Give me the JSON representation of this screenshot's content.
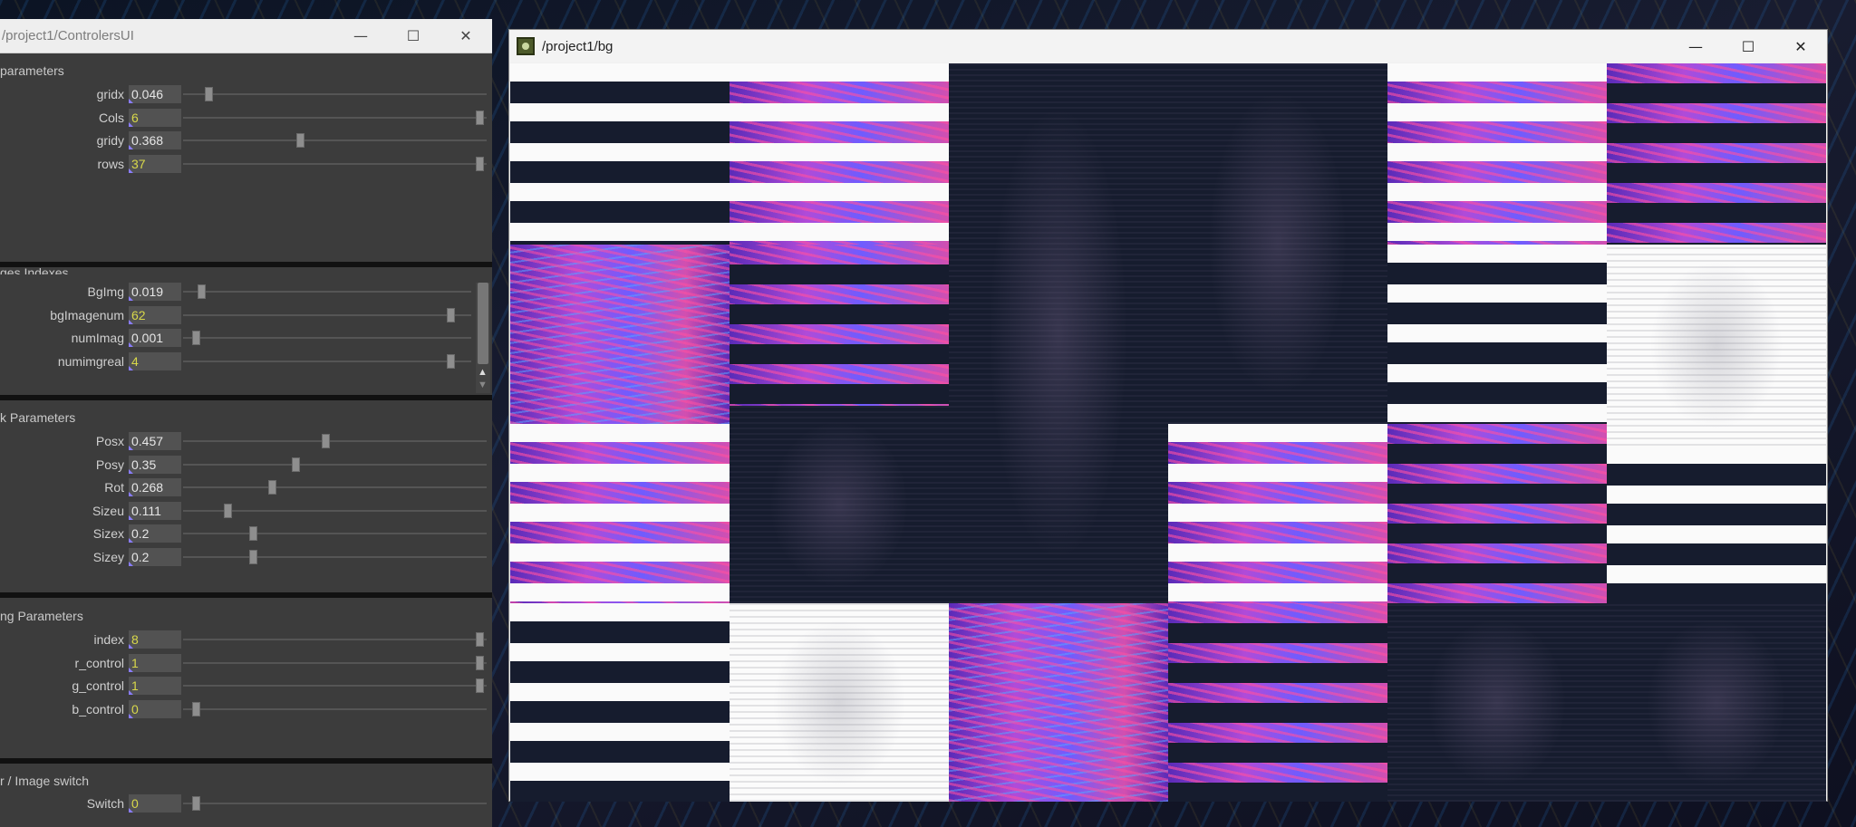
{
  "left_window": {
    "title": "/project1/ControlersUI",
    "sections": {
      "grid": "parameters",
      "images": "ges Indexes",
      "transform": "k Parameters",
      "color": "ng Parameters",
      "switch": "r / Image switch"
    },
    "params": {
      "gridx": {
        "label": "gridx",
        "value": "0.046",
        "kind": "float",
        "level": 0.046
      },
      "cols": {
        "label": "Cols",
        "value": "6",
        "kind": "int",
        "level": 1.0
      },
      "gridy": {
        "label": "gridy",
        "value": "0.368",
        "kind": "float",
        "level": 0.368
      },
      "rows": {
        "label": "rows",
        "value": "37",
        "kind": "int",
        "level": 1.0
      },
      "bgimg": {
        "label": "BgImg",
        "value": "0.019",
        "kind": "float",
        "level": 0.019
      },
      "bgimagenum": {
        "label": "bgImagenum",
        "value": "62",
        "kind": "int",
        "level": 0.95
      },
      "numimag": {
        "label": "numImag",
        "value": "0.001",
        "kind": "float",
        "level": 0.001
      },
      "numimgreal": {
        "label": "numimgreal",
        "value": "4",
        "kind": "int",
        "level": 0.95
      },
      "posx": {
        "label": "Posx",
        "value": "0.457",
        "kind": "float",
        "level": 0.457
      },
      "posy": {
        "label": "Posy",
        "value": "0.35",
        "kind": "float",
        "level": 0.35
      },
      "rot": {
        "label": "Rot",
        "value": "0.268",
        "kind": "float",
        "level": 0.268
      },
      "sizeu": {
        "label": "Sizeu",
        "value": "0.111",
        "kind": "float",
        "level": 0.111
      },
      "sizex": {
        "label": "Sizex",
        "value": "0.2",
        "kind": "float",
        "level": 0.2
      },
      "sizey": {
        "label": "Sizey",
        "value": "0.2",
        "kind": "float",
        "level": 0.2
      },
      "index": {
        "label": "index",
        "value": "8",
        "kind": "int",
        "level": 1.0
      },
      "r_control": {
        "label": "r_control",
        "value": "1",
        "kind": "int",
        "level": 1.0
      },
      "g_control": {
        "label": "g_control",
        "value": "1",
        "kind": "int",
        "level": 1.0
      },
      "b_control": {
        "label": "b_control",
        "value": "0",
        "kind": "int",
        "level": 0.0
      },
      "switch": {
        "label": "Switch",
        "value": "0",
        "kind": "int",
        "level": 0.0
      }
    }
  },
  "right_window": {
    "title": "/project1/bg"
  },
  "colors": {
    "panel_bg": "#3c3c3c",
    "value_bg": "#525252",
    "int_value": "#d8d84a",
    "float_value": "#e6e6e6",
    "canvas_dark": "#161c2e"
  },
  "icons": {
    "minimize": "minimize-icon",
    "maximize": "maximize-icon",
    "close": "close-icon",
    "app": "touchdesigner-icon"
  }
}
